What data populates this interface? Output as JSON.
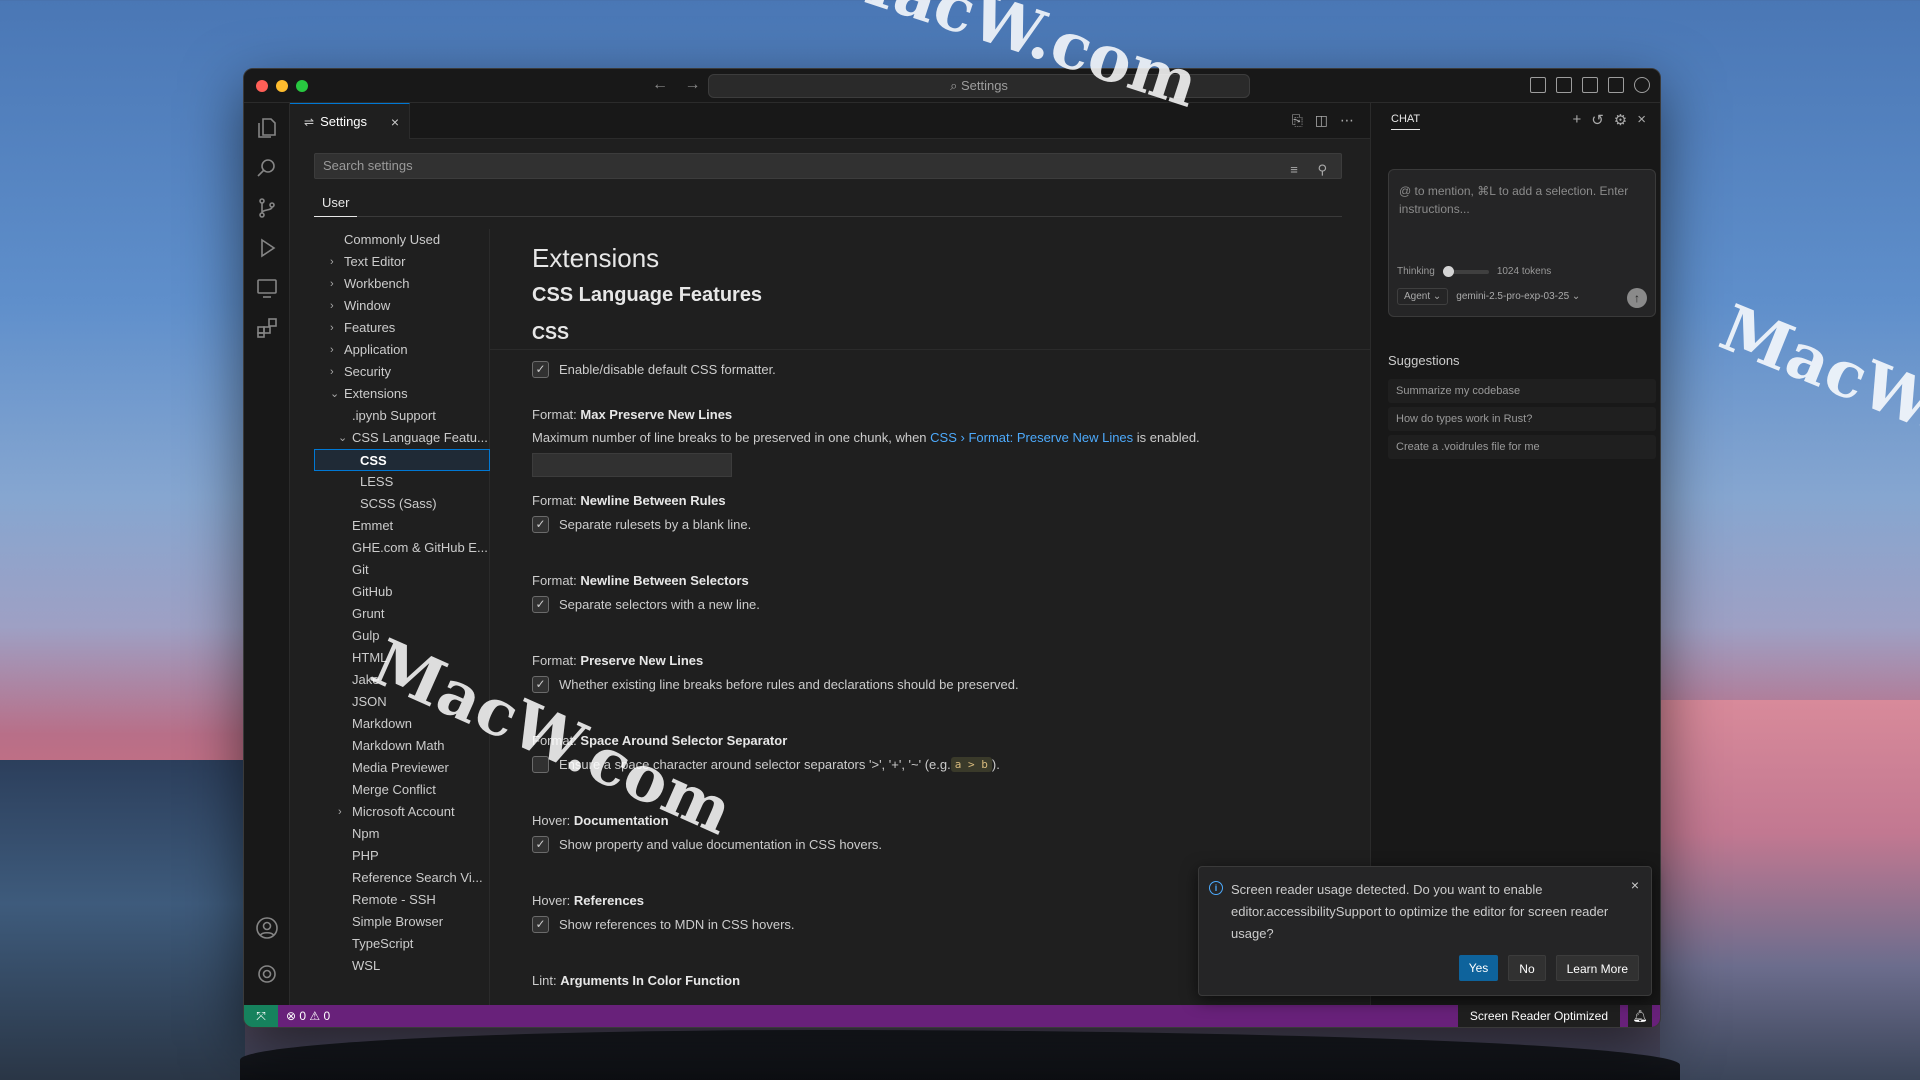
{
  "desktop": {
    "watermarks": [
      "MacW.com",
      "MacW.com",
      "MacW.com"
    ]
  },
  "window": {
    "command_center": "⌕ Settings",
    "nav_back": "←",
    "nav_forward": "→"
  },
  "activity_bar": {
    "icons": [
      "explorer-icon",
      "search-icon",
      "source-control-icon",
      "run-debug-icon",
      "remote-explorer-icon",
      "extensions-icon",
      "account-icon",
      "manage-gear-icon"
    ]
  },
  "editor": {
    "tab_glyph": "⇌",
    "tab_label": "Settings",
    "tab_close": "×",
    "tab_actions": [
      "⎘",
      "◫",
      "⋯"
    ],
    "search_placeholder": "Search settings",
    "search_icons": "≡ ⚲",
    "scope_tab": "User",
    "toc": [
      {
        "label": "Commonly Used",
        "chev": ""
      },
      {
        "label": "Text Editor",
        "chev": "›"
      },
      {
        "label": "Workbench",
        "chev": "›"
      },
      {
        "label": "Window",
        "chev": "›"
      },
      {
        "label": "Features",
        "chev": "›"
      },
      {
        "label": "Application",
        "chev": "›"
      },
      {
        "label": "Security",
        "chev": "›"
      },
      {
        "label": "Extensions",
        "chev": "⌄"
      },
      {
        "label": ".ipynb Support",
        "chev": ""
      },
      {
        "label": "CSS Language Featu...",
        "chev": "⌄"
      },
      {
        "label": "CSS",
        "chev": ""
      },
      {
        "label": "LESS",
        "chev": ""
      },
      {
        "label": "SCSS (Sass)",
        "chev": ""
      },
      {
        "label": "Emmet",
        "chev": ""
      },
      {
        "label": "GHE.com & GitHub E...",
        "chev": ""
      },
      {
        "label": "Git",
        "chev": ""
      },
      {
        "label": "GitHub",
        "chev": ""
      },
      {
        "label": "Grunt",
        "chev": ""
      },
      {
        "label": "Gulp",
        "chev": ""
      },
      {
        "label": "HTML",
        "chev": ""
      },
      {
        "label": "Jake",
        "chev": ""
      },
      {
        "label": "JSON",
        "chev": ""
      },
      {
        "label": "Markdown",
        "chev": ""
      },
      {
        "label": "Markdown Math",
        "chev": ""
      },
      {
        "label": "Media Previewer",
        "chev": ""
      },
      {
        "label": "Merge Conflict",
        "chev": ""
      },
      {
        "label": "Microsoft Account",
        "chev": "›"
      },
      {
        "label": "Npm",
        "chev": ""
      },
      {
        "label": "PHP",
        "chev": ""
      },
      {
        "label": "Reference Search Vi...",
        "chev": ""
      },
      {
        "label": "Remote - SSH",
        "chev": ""
      },
      {
        "label": "Simple Browser",
        "chev": ""
      },
      {
        "label": "TypeScript",
        "chev": ""
      },
      {
        "label": "WSL",
        "chev": ""
      }
    ],
    "headings": {
      "extensions": "Extensions",
      "css_language_features": "CSS Language Features",
      "css": "CSS"
    },
    "settings": {
      "enable_formatter": {
        "desc": "Enable/disable default CSS formatter.",
        "checked": true
      },
      "max_preserve": {
        "category": "Format: ",
        "name": "Max Preserve New Lines",
        "desc_before": "Maximum number of line breaks to be preserved in one chunk, when ",
        "link": "CSS › Format: Preserve New Lines",
        "desc_after": " is enabled.",
        "value": ""
      },
      "newline_rules": {
        "category": "Format: ",
        "name": "Newline Between Rules",
        "desc": "Separate rulesets by a blank line.",
        "checked": true
      },
      "newline_selectors": {
        "category": "Format: ",
        "name": "Newline Between Selectors",
        "desc": "Separate selectors with a new line.",
        "checked": true
      },
      "preserve_new_lines": {
        "category": "Format: ",
        "name": "Preserve New Lines",
        "desc": "Whether existing line breaks before rules and declarations should be preserved.",
        "checked": true
      },
      "space_around": {
        "category": "Format: ",
        "name": "Space Around Selector Separator",
        "desc_before": "Ensure a space character around selector separators '>', '+', '~' (e.g. ",
        "code": "a > b",
        "desc_after": ").",
        "checked": false
      },
      "hover_docs": {
        "category": "Hover: ",
        "name": "Documentation",
        "desc": "Show property and value documentation in CSS hovers.",
        "checked": true
      },
      "hover_refs": {
        "category": "Hover: ",
        "name": "References",
        "desc": "Show references to MDN in CSS hovers.",
        "checked": true
      },
      "lint_partial": {
        "category": "Lint: ",
        "name": "Arguments In Color Function"
      }
    },
    "check_glyph": "✓"
  },
  "chat": {
    "title": "CHAT",
    "actions": [
      "+",
      "↺",
      "⚙",
      "×"
    ],
    "placeholder": "@ to mention, ⌘L to add a selection. Enter instructions...",
    "thinking_label": "Thinking",
    "tokens": "1024 tokens",
    "thinking_level": 0,
    "mode": "Agent ⌄",
    "model": "gemini-2.5-pro-exp-03-25 ⌄",
    "send": "↑",
    "suggestions_title": "Suggestions",
    "suggestions": [
      "Summarize my codebase",
      "How do types work in Rust?",
      "Create a .voidrules file for me"
    ]
  },
  "notification": {
    "info": "i",
    "message": "Screen reader usage detected. Do you want to enable editor.accessibilitySupport to optimize the editor for screen reader usage?",
    "close": "×",
    "yes": "Yes",
    "no": "No",
    "learn_more": "Learn More"
  },
  "statusbar": {
    "remote": "⤧",
    "problems": "⊗ 0 ⚠ 0",
    "screen_reader": "Screen Reader Optimized",
    "bell": "🔔︎",
    "color": "#68217a"
  }
}
